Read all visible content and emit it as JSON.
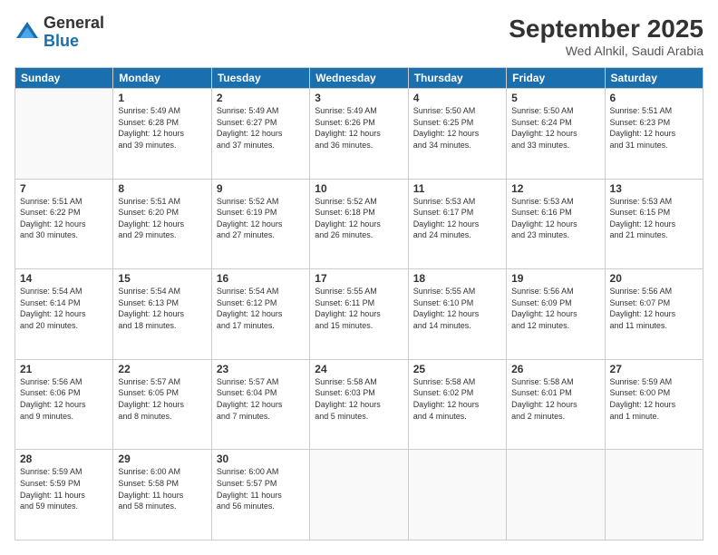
{
  "logo": {
    "general": "General",
    "blue": "Blue"
  },
  "header": {
    "month": "September 2025",
    "location": "Wed Alnkil, Saudi Arabia"
  },
  "weekdays": [
    "Sunday",
    "Monday",
    "Tuesday",
    "Wednesday",
    "Thursday",
    "Friday",
    "Saturday"
  ],
  "weeks": [
    [
      {
        "day": "",
        "info": ""
      },
      {
        "day": "1",
        "info": "Sunrise: 5:49 AM\nSunset: 6:28 PM\nDaylight: 12 hours\nand 39 minutes."
      },
      {
        "day": "2",
        "info": "Sunrise: 5:49 AM\nSunset: 6:27 PM\nDaylight: 12 hours\nand 37 minutes."
      },
      {
        "day": "3",
        "info": "Sunrise: 5:49 AM\nSunset: 6:26 PM\nDaylight: 12 hours\nand 36 minutes."
      },
      {
        "day": "4",
        "info": "Sunrise: 5:50 AM\nSunset: 6:25 PM\nDaylight: 12 hours\nand 34 minutes."
      },
      {
        "day": "5",
        "info": "Sunrise: 5:50 AM\nSunset: 6:24 PM\nDaylight: 12 hours\nand 33 minutes."
      },
      {
        "day": "6",
        "info": "Sunrise: 5:51 AM\nSunset: 6:23 PM\nDaylight: 12 hours\nand 31 minutes."
      }
    ],
    [
      {
        "day": "7",
        "info": "Sunrise: 5:51 AM\nSunset: 6:22 PM\nDaylight: 12 hours\nand 30 minutes."
      },
      {
        "day": "8",
        "info": "Sunrise: 5:51 AM\nSunset: 6:20 PM\nDaylight: 12 hours\nand 29 minutes."
      },
      {
        "day": "9",
        "info": "Sunrise: 5:52 AM\nSunset: 6:19 PM\nDaylight: 12 hours\nand 27 minutes."
      },
      {
        "day": "10",
        "info": "Sunrise: 5:52 AM\nSunset: 6:18 PM\nDaylight: 12 hours\nand 26 minutes."
      },
      {
        "day": "11",
        "info": "Sunrise: 5:53 AM\nSunset: 6:17 PM\nDaylight: 12 hours\nand 24 minutes."
      },
      {
        "day": "12",
        "info": "Sunrise: 5:53 AM\nSunset: 6:16 PM\nDaylight: 12 hours\nand 23 minutes."
      },
      {
        "day": "13",
        "info": "Sunrise: 5:53 AM\nSunset: 6:15 PM\nDaylight: 12 hours\nand 21 minutes."
      }
    ],
    [
      {
        "day": "14",
        "info": "Sunrise: 5:54 AM\nSunset: 6:14 PM\nDaylight: 12 hours\nand 20 minutes."
      },
      {
        "day": "15",
        "info": "Sunrise: 5:54 AM\nSunset: 6:13 PM\nDaylight: 12 hours\nand 18 minutes."
      },
      {
        "day": "16",
        "info": "Sunrise: 5:54 AM\nSunset: 6:12 PM\nDaylight: 12 hours\nand 17 minutes."
      },
      {
        "day": "17",
        "info": "Sunrise: 5:55 AM\nSunset: 6:11 PM\nDaylight: 12 hours\nand 15 minutes."
      },
      {
        "day": "18",
        "info": "Sunrise: 5:55 AM\nSunset: 6:10 PM\nDaylight: 12 hours\nand 14 minutes."
      },
      {
        "day": "19",
        "info": "Sunrise: 5:56 AM\nSunset: 6:09 PM\nDaylight: 12 hours\nand 12 minutes."
      },
      {
        "day": "20",
        "info": "Sunrise: 5:56 AM\nSunset: 6:07 PM\nDaylight: 12 hours\nand 11 minutes."
      }
    ],
    [
      {
        "day": "21",
        "info": "Sunrise: 5:56 AM\nSunset: 6:06 PM\nDaylight: 12 hours\nand 9 minutes."
      },
      {
        "day": "22",
        "info": "Sunrise: 5:57 AM\nSunset: 6:05 PM\nDaylight: 12 hours\nand 8 minutes."
      },
      {
        "day": "23",
        "info": "Sunrise: 5:57 AM\nSunset: 6:04 PM\nDaylight: 12 hours\nand 7 minutes."
      },
      {
        "day": "24",
        "info": "Sunrise: 5:58 AM\nSunset: 6:03 PM\nDaylight: 12 hours\nand 5 minutes."
      },
      {
        "day": "25",
        "info": "Sunrise: 5:58 AM\nSunset: 6:02 PM\nDaylight: 12 hours\nand 4 minutes."
      },
      {
        "day": "26",
        "info": "Sunrise: 5:58 AM\nSunset: 6:01 PM\nDaylight: 12 hours\nand 2 minutes."
      },
      {
        "day": "27",
        "info": "Sunrise: 5:59 AM\nSunset: 6:00 PM\nDaylight: 12 hours\nand 1 minute."
      }
    ],
    [
      {
        "day": "28",
        "info": "Sunrise: 5:59 AM\nSunset: 5:59 PM\nDaylight: 11 hours\nand 59 minutes."
      },
      {
        "day": "29",
        "info": "Sunrise: 6:00 AM\nSunset: 5:58 PM\nDaylight: 11 hours\nand 58 minutes."
      },
      {
        "day": "30",
        "info": "Sunrise: 6:00 AM\nSunset: 5:57 PM\nDaylight: 11 hours\nand 56 minutes."
      },
      {
        "day": "",
        "info": ""
      },
      {
        "day": "",
        "info": ""
      },
      {
        "day": "",
        "info": ""
      },
      {
        "day": "",
        "info": ""
      }
    ]
  ]
}
